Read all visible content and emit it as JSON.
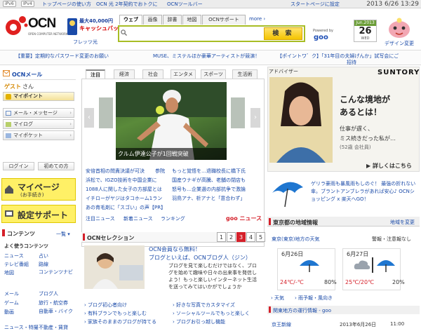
{
  "topbar": {
    "badges": [
      "iPv6",
      "IPv4"
    ],
    "links": [
      "トップページの使い方",
      "OCN 光 2年契約でおトクに",
      "OCNツールバー"
    ],
    "start_link": "スタートページに設定",
    "datetime": "2013 6/26 13:29"
  },
  "header": {
    "logo_text": "OCN",
    "logo_sub": "OPEN COMPUTER NETWORK",
    "promo_line1": "最大40,000円",
    "promo_line2": "キャッシュバック!",
    "promo_caption": "フレッツ光"
  },
  "search": {
    "tabs": [
      "ウェブ",
      "画像",
      "辞書",
      "地図",
      "OCNサポート"
    ],
    "more": "more",
    "button": "検 索",
    "powered": "Powered by",
    "engine": "goo"
  },
  "calendar": {
    "month": "Jun.2013",
    "day": "26",
    "weekday": "WED"
  },
  "design_label": "デザイン変更",
  "newsbar": {
    "items": [
      "【重要】定期的なパスワード変更のお願い",
      "MUSE、ミステルほか豪華アーティストが競演！",
      "【ポイントワ゛ク】「31年目の夫婦げんか」試写会にご",
      "招待"
    ]
  },
  "left": {
    "mail_title": "OCNメール",
    "guest": "ゲスト",
    "san": "さん",
    "buttons": [
      "マイポイント",
      "メール・メッセージ",
      "マイログ",
      "マイポケット"
    ],
    "login": "ログイン",
    "first_time": "初めての方",
    "mypage": "マイページ",
    "mypage_sub": "(お手続き)",
    "support": "設定サポート",
    "contents": "コンテンツ",
    "list_label": "一覧",
    "favorites": "よく使うコンテンツ",
    "links": [
      "ニュース",
      "占い",
      "テレビ番組",
      "路線",
      "地図",
      "コンテンツナビ",
      "メール",
      "ブログ人",
      "ゲーム",
      "旅行・航空券",
      "動画",
      "自動車・バイク",
      "ニュース・特撮",
      "不動産・賃貸"
    ]
  },
  "center": {
    "tabs": [
      "注目",
      "経済",
      "社会",
      "エンタメ",
      "スポーツ",
      "生活術"
    ],
    "photo_caption": "クルム伊達公子が1回戦突破",
    "news": [
      "安倍首相の問責決議が可決",
      "参院",
      "もっと覚悟を…退職校長に橋下氏",
      "浜松で、IGZO技術を中国企業に",
      "国産ウナギが高騰、老舗の閉店も",
      "1088人に関した女子の方部屋とは",
      "怒号も…企業選の内部抗争で激論",
      "イチローがヤジはタコホーム1ラン",
      "羽鳥アナ、析アナと「意合わず」",
      "あの育毛剤に「スゴい」の声【PR】"
    ],
    "bottom_tabs": [
      "注目ニュース",
      "新着ニュース",
      "ランキング"
    ],
    "goo_news": "goo ニュース"
  },
  "selection": {
    "title": "OCNセレクション",
    "pages": [
      "1",
      "2",
      "3",
      "4",
      "5"
    ],
    "current": "3",
    "item_title1": "OCN会員なら無料！",
    "item_title2": "ブログといえば、OCNブログ人（ジン）",
    "item_body": "ブログを見て楽しむだけではなく、ブログを始めて趣味や日々の出来事を発信しよう！もっと楽しいインターネット生活を送ってみてはいかがでしょうか",
    "links": [
      "ブログ初心者向け",
      "好きな写真でカスタマイズ",
      "有料ブランでもっと楽しむ",
      "ソーシャルツールでもっと楽しく",
      "家族そのままのブログが持てる",
      "ブログお引っ越し機能"
    ]
  },
  "ad": {
    "label": "アドバイザー",
    "brand": "SUNTORY",
    "headline1": "こんな境地が",
    "headline2": "あるとは！",
    "body1": "仕事が遅く、",
    "body2": "ミス続きだった私が…",
    "body3": "(52歳 会社員)",
    "more": "詳しくはこちら"
  },
  "promo_text": "ゲリラ豪雨も暴風雨もしのぐ！ 最強の折れない傘。ブラントアンブレラがあれば安心♪ OCNショッピング x 楽天へGO！",
  "region": {
    "title": "東京都の地域情報",
    "change": "地域を変更",
    "area": "東京(東京)地方の天気",
    "warn": "警報・注意報なし",
    "days": [
      {
        "date": "6月26日",
        "temp": "24℃/-℃",
        "rain": "80%"
      },
      {
        "date": "6月27日",
        "temp": "25℃/20℃",
        "rain": "20%"
      }
    ],
    "links": [
      "天気",
      "雨予報・風向き"
    ],
    "train_title": "関東地方の運行情報 - goo",
    "train_line": "京王新線",
    "train_date": "2013年6月26日",
    "train_time": "11:00"
  },
  "colors": {
    "search_border": "#a8bd25",
    "accent_red": "#d5202a",
    "link_blue": "#1a4aa8",
    "yellow": "#fff066"
  }
}
